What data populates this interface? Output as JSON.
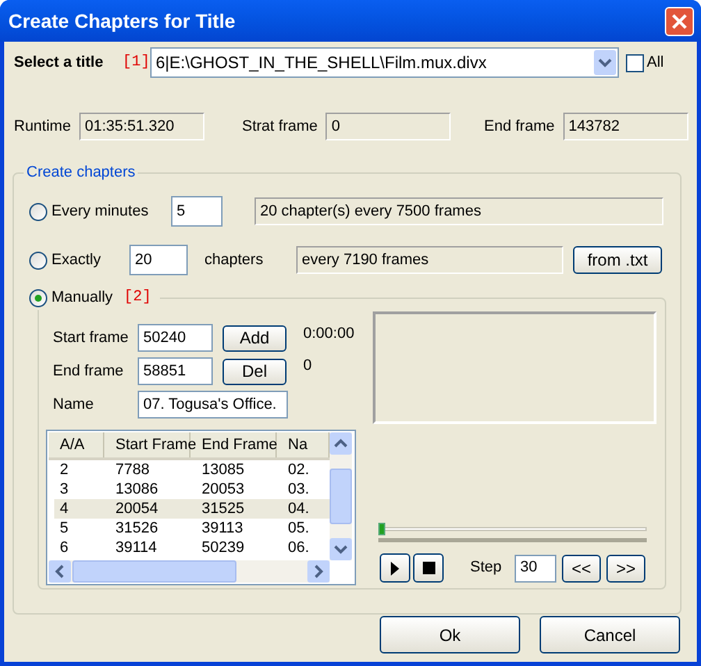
{
  "window": {
    "title": "Create Chapters for Title"
  },
  "title_select": {
    "label": "Select a title",
    "marker": "[1]",
    "value": "6|E:\\GHOST_IN_THE_SHELL\\Film.mux.divx",
    "all": {
      "label": "All",
      "checked": false
    }
  },
  "info": [
    {
      "label": "Runtime",
      "value": "01:35:51.320"
    },
    {
      "label": "Strat frame",
      "value": "0"
    },
    {
      "label": "End frame",
      "value": "143782"
    }
  ],
  "group": {
    "title": "Create chapters",
    "every_minutes": {
      "label": "Every minutes",
      "selected": false,
      "value": "5",
      "result": "20 chapter(s) every 7500 frames"
    },
    "exactly": {
      "label": "Exactly",
      "selected": false,
      "value": "20",
      "unit": "chapters",
      "result": "every 7190 frames",
      "button": "from .txt"
    },
    "manually": {
      "label": "Manually",
      "selected": true,
      "marker": "[2]",
      "fields": [
        {
          "label": "Start frame",
          "value": "50240",
          "button": "Add"
        },
        {
          "label": "End frame",
          "value": "58851",
          "button": "Del"
        },
        {
          "label": "Name",
          "value": "07. Togusa's Office."
        }
      ],
      "time": "0:00:00",
      "frame": "0",
      "table": {
        "columns": [
          "A/A",
          "Start Frame",
          "End Frame",
          "Na"
        ],
        "rows": [
          {
            "cells": [
              "2",
              "7788",
              "13085",
              "02."
            ],
            "selected": false
          },
          {
            "cells": [
              "3",
              "13086",
              "20053",
              "03."
            ],
            "selected": false
          },
          {
            "cells": [
              "4",
              "20054",
              "31525",
              "04."
            ],
            "selected": true
          },
          {
            "cells": [
              "5",
              "31526",
              "39113",
              "05."
            ],
            "selected": false
          },
          {
            "cells": [
              "6",
              "39114",
              "50239",
              "06."
            ],
            "selected": false
          }
        ]
      },
      "slider": {
        "level": 0
      },
      "step": {
        "label": "Step",
        "value": "30"
      },
      "nav": [
        "<<",
        ">>"
      ]
    }
  },
  "buttons": [
    "Ok",
    "Cancel"
  ]
}
